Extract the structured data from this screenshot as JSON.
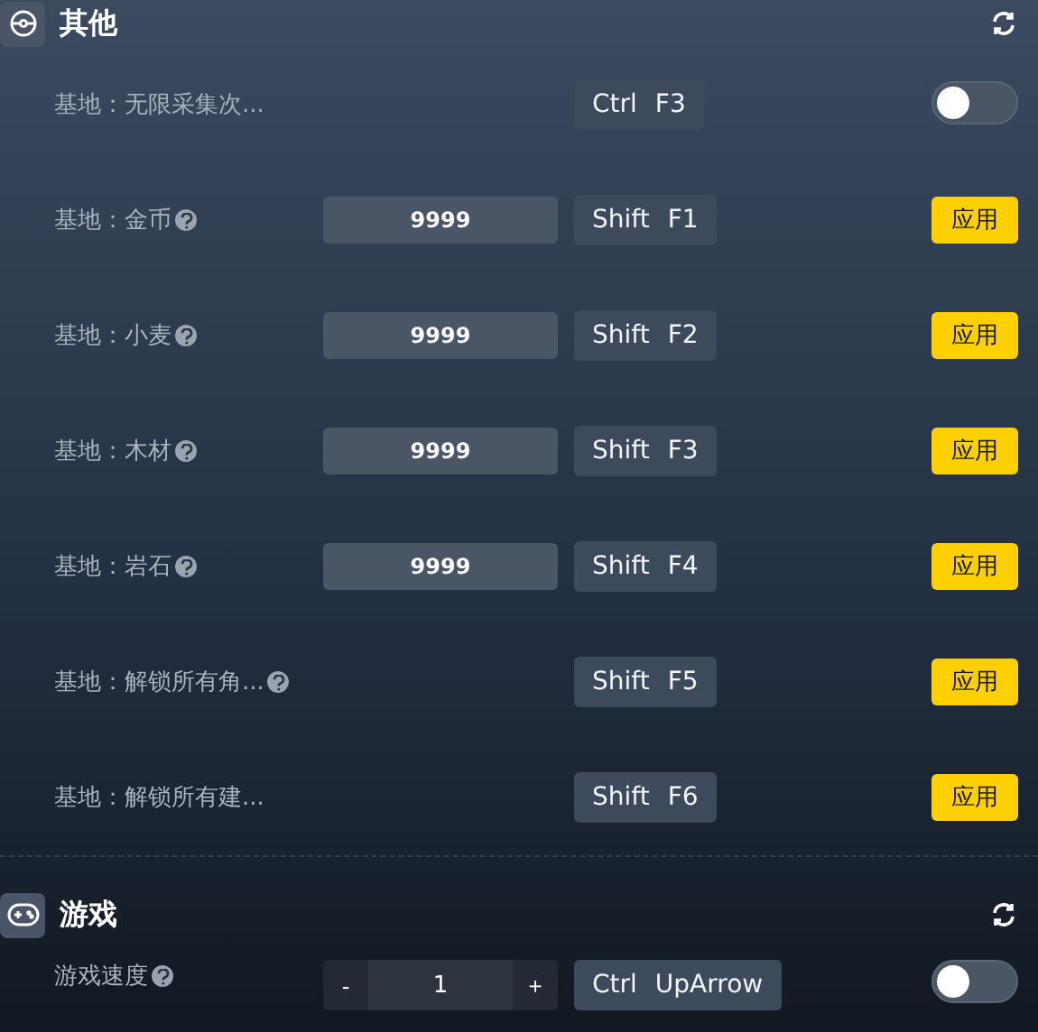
{
  "sections": [
    {
      "title": "其他",
      "rows": [
        {
          "kind": "toggle",
          "label": "基地：无限采集次...",
          "help": false,
          "keys": [
            "Ctrl",
            "F3"
          ],
          "on": false
        },
        {
          "kind": "input",
          "label": "基地：金币",
          "help": true,
          "value": "9999",
          "keys": [
            "Shift",
            "F1"
          ],
          "action": "应用"
        },
        {
          "kind": "input",
          "label": "基地：小麦",
          "help": true,
          "value": "9999",
          "keys": [
            "Shift",
            "F2"
          ],
          "action": "应用"
        },
        {
          "kind": "input",
          "label": "基地：木材",
          "help": true,
          "value": "9999",
          "keys": [
            "Shift",
            "F3"
          ],
          "action": "应用"
        },
        {
          "kind": "input",
          "label": "基地：岩石",
          "help": true,
          "value": "9999",
          "keys": [
            "Shift",
            "F4"
          ],
          "action": "应用"
        },
        {
          "kind": "button",
          "label": "基地：解锁所有角...",
          "help": true,
          "keys": [
            "Shift",
            "F5"
          ],
          "action": "应用"
        },
        {
          "kind": "button",
          "label": "基地：解锁所有建...",
          "help": false,
          "keys": [
            "Shift",
            "F6"
          ],
          "action": "应用"
        }
      ]
    },
    {
      "title": "游戏",
      "rows": [
        {
          "kind": "stepper",
          "label": "游戏速度",
          "help": true,
          "minus": "-",
          "value": "1",
          "plus": "+",
          "keys": [
            "Ctrl",
            "UpArrow"
          ],
          "on": false
        }
      ]
    }
  ]
}
